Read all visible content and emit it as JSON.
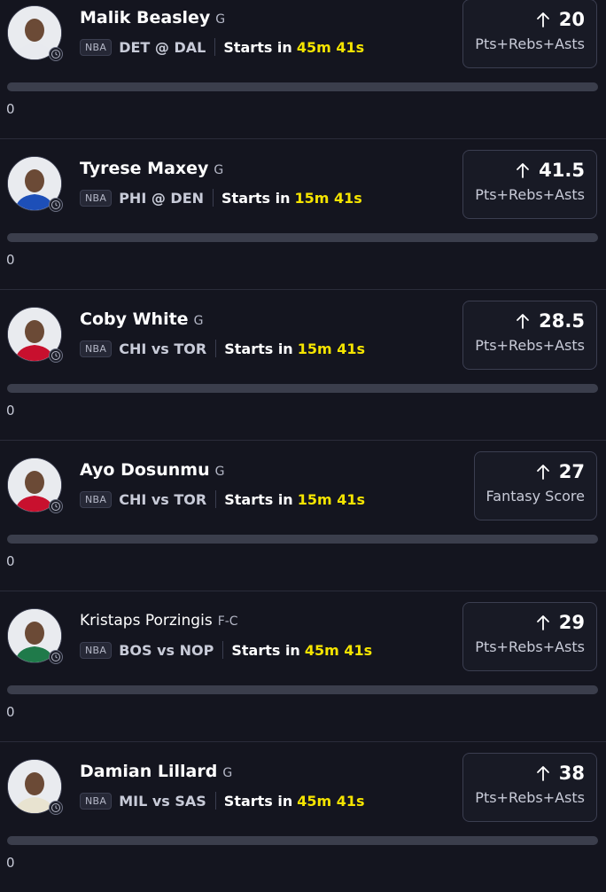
{
  "players": [
    {
      "name": "Malik Beasley",
      "position": "G",
      "league": "NBA",
      "matchup": "DET @ DAL",
      "starts_label": "Starts in",
      "countdown": "45m 41s",
      "line": "20",
      "stat_type": "Pts+Rebs+Asts",
      "direction_icon": "arrow-up-icon",
      "progress_value": "0",
      "jersey_color": "#e8eaef"
    },
    {
      "name": "Tyrese Maxey",
      "position": "G",
      "league": "NBA",
      "matchup": "PHI @ DEN",
      "starts_label": "Starts in",
      "countdown": "15m 41s",
      "line": "41.5",
      "stat_type": "Pts+Rebs+Asts",
      "direction_icon": "arrow-up-icon",
      "progress_value": "0",
      "jersey_color": "#1d4fb8"
    },
    {
      "name": "Coby White",
      "position": "G",
      "league": "NBA",
      "matchup": "CHI vs TOR",
      "starts_label": "Starts in",
      "countdown": "15m 41s",
      "line": "28.5",
      "stat_type": "Pts+Rebs+Asts",
      "direction_icon": "arrow-up-icon",
      "progress_value": "0",
      "jersey_color": "#c8102e"
    },
    {
      "name": "Ayo Dosunmu",
      "position": "G",
      "league": "NBA",
      "matchup": "CHI vs TOR",
      "starts_label": "Starts in",
      "countdown": "15m 41s",
      "line": "27",
      "stat_type": "Fantasy Score",
      "direction_icon": "arrow-up-icon",
      "progress_value": "0",
      "jersey_color": "#c8102e"
    },
    {
      "name": "Kristaps Porzingis",
      "position": "F-C",
      "league": "NBA",
      "matchup": "BOS vs NOP",
      "starts_label": "Starts in",
      "countdown": "45m 41s",
      "line": "29",
      "stat_type": "Pts+Rebs+Asts",
      "direction_icon": "arrow-up-icon",
      "progress_value": "0",
      "jersey_color": "#1f7a4a"
    },
    {
      "name": "Damian Lillard",
      "position": "G",
      "league": "NBA",
      "matchup": "MIL vs SAS",
      "starts_label": "Starts in",
      "countdown": "45m 41s",
      "line": "38",
      "stat_type": "Pts+Rebs+Asts",
      "direction_icon": "arrow-up-icon",
      "progress_value": "0",
      "jersey_color": "#e8e3d0"
    }
  ],
  "colors": {
    "background": "#14151f",
    "countdown": "#f5e400",
    "track": "#3b3e4c"
  }
}
